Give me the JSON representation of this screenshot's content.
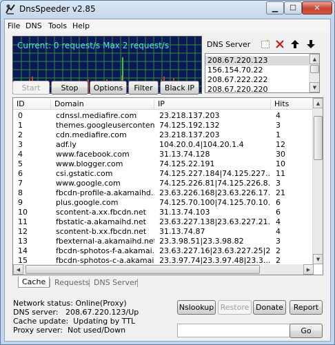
{
  "window": {
    "title": "DnsSpeeder v2.85"
  },
  "menu": [
    "File",
    "DNS",
    "Tools",
    "Help"
  ],
  "monitor": {
    "text": "Current: 0 request/s Max 2 request/s"
  },
  "dns_panel": {
    "label": "DNS Server",
    "servers": [
      "208.67.220.123",
      "156.154.70.22",
      "208.67.222.222",
      "208.67.220.220"
    ]
  },
  "buttons": {
    "start": "Start",
    "stop": "Stop",
    "options": "Options",
    "filter": "Filter",
    "blackip": "Black IP",
    "nslookup": "Nslookup",
    "restore": "Restore",
    "donate": "Donate",
    "report": "Report",
    "go": "Go"
  },
  "table": {
    "columns": [
      "ID",
      "Domain",
      "IP",
      "Hits"
    ],
    "rows": [
      {
        "id": "0",
        "domain": "cdnssl.mediafire.com",
        "ip": "23.218.137.203",
        "hits": "4"
      },
      {
        "id": "1",
        "domain": "themes.googleusercontent...",
        "ip": "74.125.192.132",
        "hits": "3"
      },
      {
        "id": "2",
        "domain": "cdn.mediafire.com",
        "ip": "23.218.137.203",
        "hits": "1"
      },
      {
        "id": "3",
        "domain": "adf.ly",
        "ip": "104.20.0.4|104.20.1.4",
        "hits": "12"
      },
      {
        "id": "4",
        "domain": "www.facebook.com",
        "ip": "31.13.74.128",
        "hits": "30"
      },
      {
        "id": "5",
        "domain": "www.blogger.com",
        "ip": "74.125.22.191",
        "hits": "10"
      },
      {
        "id": "6",
        "domain": "csi.gstatic.com",
        "ip": "74.125.227.184|74.125.227....",
        "hits": "11"
      },
      {
        "id": "7",
        "domain": "www.google.com",
        "ip": "74.125.226.81|74.125.226.8...",
        "hits": "3"
      },
      {
        "id": "8",
        "domain": "fbcdn-profile-a.akamaihd....",
        "ip": "23.63.226.168|23.63.226.17...",
        "hits": "21"
      },
      {
        "id": "9",
        "domain": "plus.google.com",
        "ip": "74.125.70.100|74.125.70.10...",
        "hits": "6"
      },
      {
        "id": "10",
        "domain": "scontent-a.xx.fbcdn.net",
        "ip": "31.13.74.103",
        "hits": "6"
      },
      {
        "id": "11",
        "domain": "fbstatic-a.akamaihd.net",
        "ip": "23.63.227.138|23.63.227.21...",
        "hits": "4"
      },
      {
        "id": "12",
        "domain": "scontent-b.xx.fbcdn.net",
        "ip": "31.13.74.87",
        "hits": "4"
      },
      {
        "id": "13",
        "domain": "fbexternal-a.akamaihd.net",
        "ip": "23.3.98.51|23.3.98.82",
        "hits": "3"
      },
      {
        "id": "14",
        "domain": "fbcdn-sphotos-f-a.akamai...",
        "ip": "23.63.227.16|23.63.227.25|2...",
        "hits": "2"
      },
      {
        "id": "15",
        "domain": "fbcdn-sphotos-c-a.akamai...",
        "ip": "23.3.97.74|23.3.97.48|23.3....",
        "hits": "2"
      }
    ]
  },
  "tabs": [
    "Cache",
    "Requests",
    "DNS Server"
  ],
  "status": {
    "network_label": "Network status:",
    "network_value": "Online(Proxy)",
    "dns_label": "DNS server:",
    "dns_value": "208.67.220.123/Up",
    "cache_label": "Cache update:",
    "cache_value": "Updating by TTL",
    "proxy_label": "Proxy server:",
    "proxy_value": "Not used/Down"
  },
  "colors": {
    "monitor_bg": "#0b1a55",
    "monitor_grid": "#2f8c3a",
    "monitor_text": "#4de0e6",
    "spike": "#d23a3a"
  }
}
